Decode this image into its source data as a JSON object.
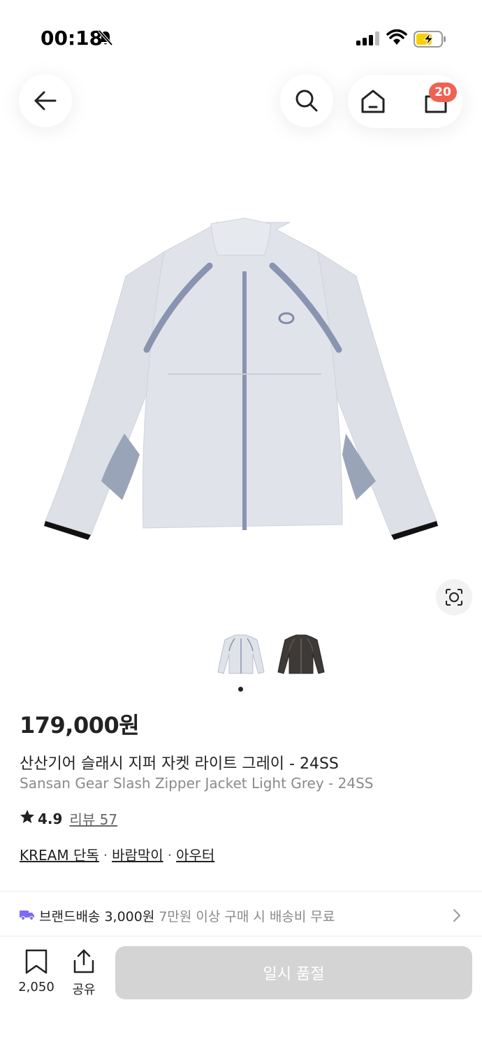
{
  "status_bar": {
    "time": "00:18"
  },
  "header": {
    "cart_count": "20"
  },
  "product": {
    "price": "179,000원",
    "title_ko": "산산기어 슬래시 지퍼 자켓 라이트 그레이 - 24SS",
    "title_en": "Sansan Gear Slash Zipper Jacket Light Grey - 24SS",
    "rating": "4.9",
    "review_label": "리뷰 57",
    "tags": [
      "KREAM 단독",
      "바람막이",
      "아우터"
    ],
    "tag_separator": "·"
  },
  "shipping": {
    "label": "브랜드배송 3,000원",
    "note": "7만원 이상 구매 시 배송비 무료"
  },
  "bottom_bar": {
    "bookmark_count": "2,050",
    "share_label": "공유",
    "buy_label": "일시 품절"
  },
  "colors": {
    "badge": "#ef6253",
    "disabled_button": "#d4d4d4",
    "truck_icon": "#7b6cf6",
    "jacket_body": "#dfe3e9",
    "jacket_trim": "#8894b0"
  }
}
